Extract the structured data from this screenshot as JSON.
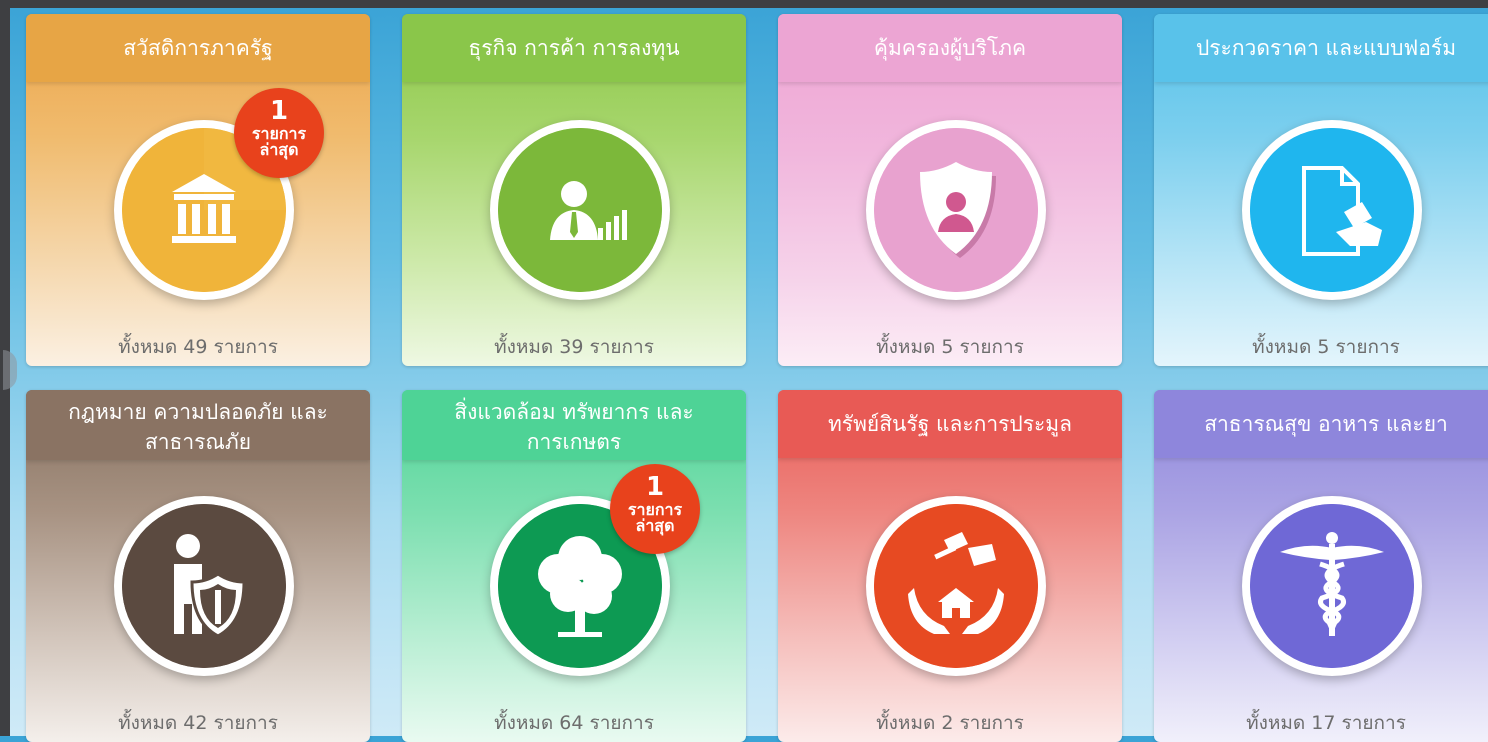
{
  "categories": [
    {
      "title": "สวัสดิการภาครัฐ",
      "count": "ทั้งหมด 49 รายการ",
      "icon": "government-building-icon",
      "color": "#eeaa44",
      "badge": {
        "num": "1",
        "text": "รายการล่าสุด"
      }
    },
    {
      "title": "ธุรกิจ การค้า การลงทุน",
      "count": "ทั้งหมด 39 รายการ",
      "icon": "businessman-chart-icon",
      "color": "#8fc74a"
    },
    {
      "title": "คุ้มครองผู้บริโภค",
      "count": "ทั้งหมด 5 รายการ",
      "icon": "consumer-shield-icon",
      "color": "#eca5d3"
    },
    {
      "title": "ประกวดราคา และแบบฟอร์ม",
      "count": "ทั้งหมด 5 รายการ",
      "icon": "document-gavel-icon",
      "color": "#5cc3ea"
    },
    {
      "title": "กฎหมาย ความปลอดภัย และสาธารณภัย",
      "count": "ทั้งหมด 42 รายการ",
      "icon": "person-shield-icon",
      "color": "#8a7363"
    },
    {
      "title": "สิ่งแวดล้อม ทรัพยากร และการเกษตร",
      "count": "ทั้งหมด 64 รายการ",
      "icon": "tree-icon",
      "color": "#4ed396",
      "badge": {
        "num": "1",
        "text": "รายการล่าสุด"
      }
    },
    {
      "title": "ทรัพย์สินรัฐ และการประมูล",
      "count": "ทั้งหมด 2 รายการ",
      "icon": "hands-house-gavel-icon",
      "color": "#e85a55"
    },
    {
      "title": "สาธารณสุข อาหาร และยา",
      "count": "ทั้งหมด 17 รายการ",
      "icon": "caduceus-icon",
      "color": "#8e86dc"
    }
  ]
}
